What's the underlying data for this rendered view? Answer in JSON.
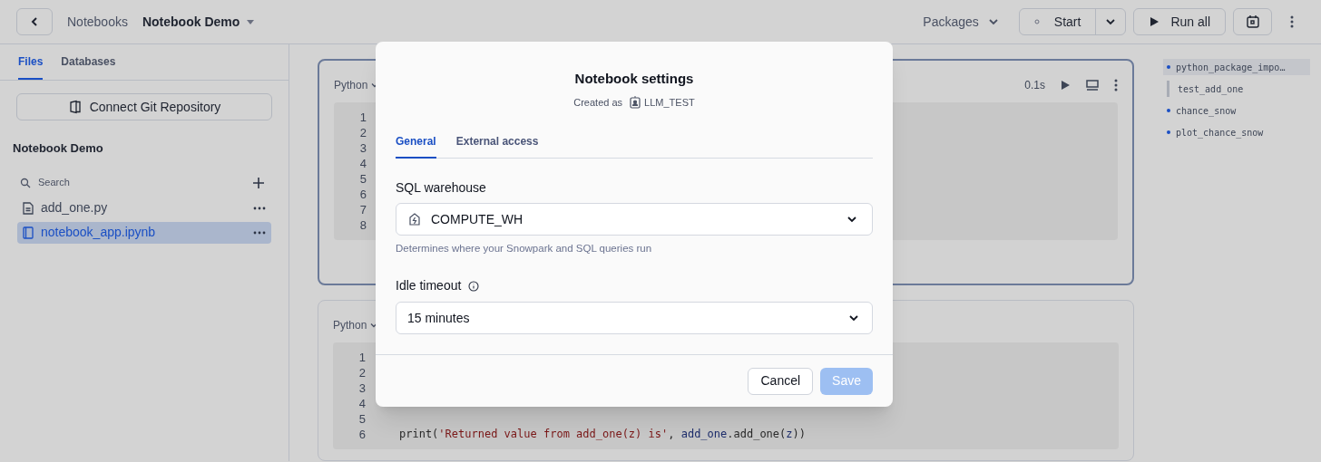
{
  "header": {
    "breadcrumb": "Notebooks",
    "title": "Notebook Demo",
    "packages": "Packages",
    "start": "Start",
    "run_all": "Run all"
  },
  "sidebar": {
    "tabs": [
      {
        "label": "Files",
        "selected": true
      },
      {
        "label": "Databases",
        "selected": false
      }
    ],
    "git_button": "Connect Git Repository",
    "project": "Notebook Demo",
    "search": {
      "placeholder": "Search"
    },
    "files": [
      {
        "name": "add_one.py",
        "kind": "file",
        "selected": false
      },
      {
        "name": "notebook_app.ipynb",
        "kind": "notebook",
        "selected": true
      }
    ]
  },
  "cells": [
    {
      "language": "Python",
      "focused": true,
      "duration": "0.1s",
      "lines": [
        {
          "number": "1"
        },
        {
          "number": "2"
        },
        {
          "number": "3"
        },
        {
          "number": "4"
        },
        {
          "number": "5"
        },
        {
          "number": "6"
        },
        {
          "number": "7"
        },
        {
          "number": "8"
        }
      ]
    },
    {
      "language": "Python",
      "focused": false,
      "lines": [
        {
          "number": "1"
        },
        {
          "number": "2"
        },
        {
          "number": "3"
        },
        {
          "number": "4"
        },
        {
          "number": "5"
        },
        {
          "number": "6",
          "tokens": [
            {
              "text": "print(",
              "kind": "plain"
            },
            {
              "text": "'Returned value from add_one(z) is'",
              "kind": "string"
            },
            {
              "text": ", ",
              "kind": "plain"
            },
            {
              "text": "add_one",
              "kind": "name"
            },
            {
              "text": ".add_one(",
              "kind": "plain"
            },
            {
              "text": "z",
              "kind": "name"
            },
            {
              "text": "))",
              "kind": "plain"
            }
          ]
        }
      ]
    }
  ],
  "outline": [
    {
      "label": "python_package_impo…",
      "kind": "dot",
      "selected": true
    },
    {
      "label": "test_add_one",
      "kind": "bar",
      "selected": false
    },
    {
      "label": "chance_snow",
      "kind": "dot",
      "selected": false
    },
    {
      "label": "plot_chance_snow",
      "kind": "dot",
      "selected": false
    }
  ],
  "modal": {
    "title": "Notebook settings",
    "created_as": "Created as",
    "user": "LLM_TEST",
    "tabs": [
      {
        "label": "General",
        "selected": true
      },
      {
        "label": "External access",
        "selected": false
      }
    ],
    "warehouse": {
      "label": "SQL warehouse",
      "value": "COMPUTE_WH",
      "help": "Determines where your Snowpark and SQL queries run"
    },
    "timeout": {
      "label": "Idle timeout",
      "value": "15 minutes"
    },
    "cancel": "Cancel",
    "save": {
      "label": "Save",
      "disabled": true
    }
  }
}
